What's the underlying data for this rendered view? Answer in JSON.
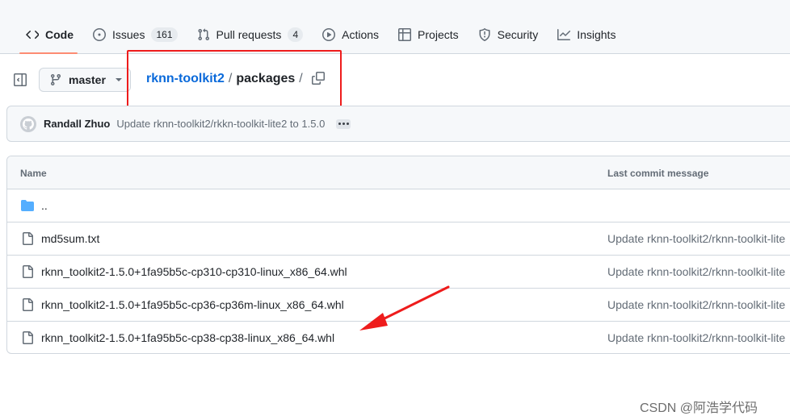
{
  "nav": {
    "tabs": [
      {
        "label": "Code",
        "icon": "code-icon",
        "active": true
      },
      {
        "label": "Issues",
        "icon": "issue-icon",
        "count": "161"
      },
      {
        "label": "Pull requests",
        "icon": "pull-request-icon",
        "count": "4"
      },
      {
        "label": "Actions",
        "icon": "play-icon"
      },
      {
        "label": "Projects",
        "icon": "table-icon"
      },
      {
        "label": "Security",
        "icon": "shield-icon"
      },
      {
        "label": "Insights",
        "icon": "graph-icon"
      }
    ]
  },
  "branch": {
    "name": "master",
    "icon": "git-branch-icon"
  },
  "breadcrumb": {
    "repo": "rknn-toolkit2",
    "separator": "/",
    "dir": "packages"
  },
  "commit": {
    "author": "Randall Zhuo",
    "message": "Update rknn-toolkit2/rkkn-toolkit-lite2 to 1.5.0"
  },
  "table": {
    "headers": {
      "name": "Name",
      "message": "Last commit message"
    },
    "rows": [
      {
        "name": "..",
        "type": "folder",
        "message": ""
      },
      {
        "name": "md5sum.txt",
        "type": "file",
        "message": "Update rknn-toolkit2/rknn-toolkit-lite"
      },
      {
        "name": "rknn_toolkit2-1.5.0+1fa95b5c-cp310-cp310-linux_x86_64.whl",
        "type": "file",
        "message": "Update rknn-toolkit2/rknn-toolkit-lite"
      },
      {
        "name": "rknn_toolkit2-1.5.0+1fa95b5c-cp36-cp36m-linux_x86_64.whl",
        "type": "file",
        "message": "Update rknn-toolkit2/rknn-toolkit-lite"
      },
      {
        "name": "rknn_toolkit2-1.5.0+1fa95b5c-cp38-cp38-linux_x86_64.whl",
        "type": "file",
        "message": "Update rknn-toolkit2/rknn-toolkit-lite"
      }
    ]
  },
  "annotations": {
    "box_color": "#ee1c1c",
    "arrow_color": "#ee1c1c"
  },
  "watermark": "CSDN @阿浩学代码"
}
